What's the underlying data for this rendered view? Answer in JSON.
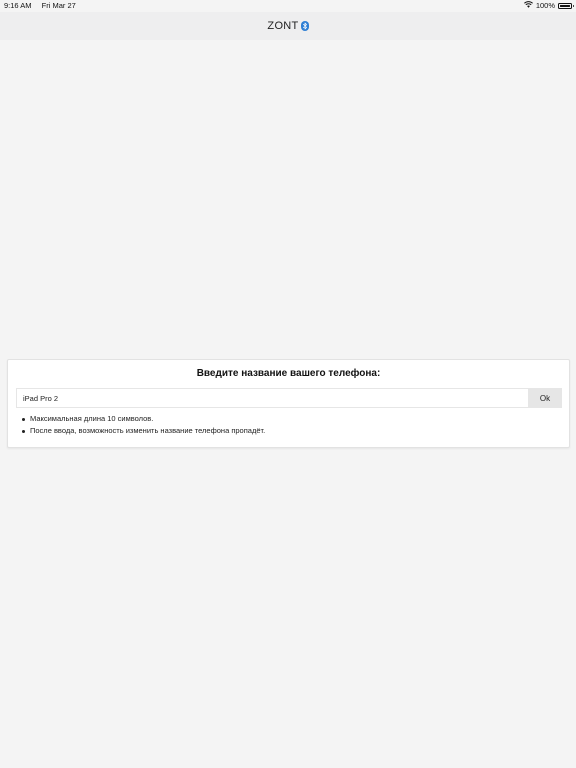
{
  "status_bar": {
    "time": "9:16 AM",
    "date": "Fri Mar 27",
    "battery_text": "100%",
    "battery_level": 1.0,
    "icons": [
      "wifi-icon",
      "battery-icon"
    ]
  },
  "header": {
    "title": "ZONT",
    "title_icon": "bluetooth-icon",
    "accent_color": "#2f7fd4"
  },
  "dialog": {
    "title": "Введите название вашего телефона:",
    "input_value": "iPad Pro 2",
    "ok_label": "Ok",
    "hints": [
      "Максимальная длина 10 символов.",
      "После ввода, возможность изменить название телефона пропадёт."
    ]
  }
}
